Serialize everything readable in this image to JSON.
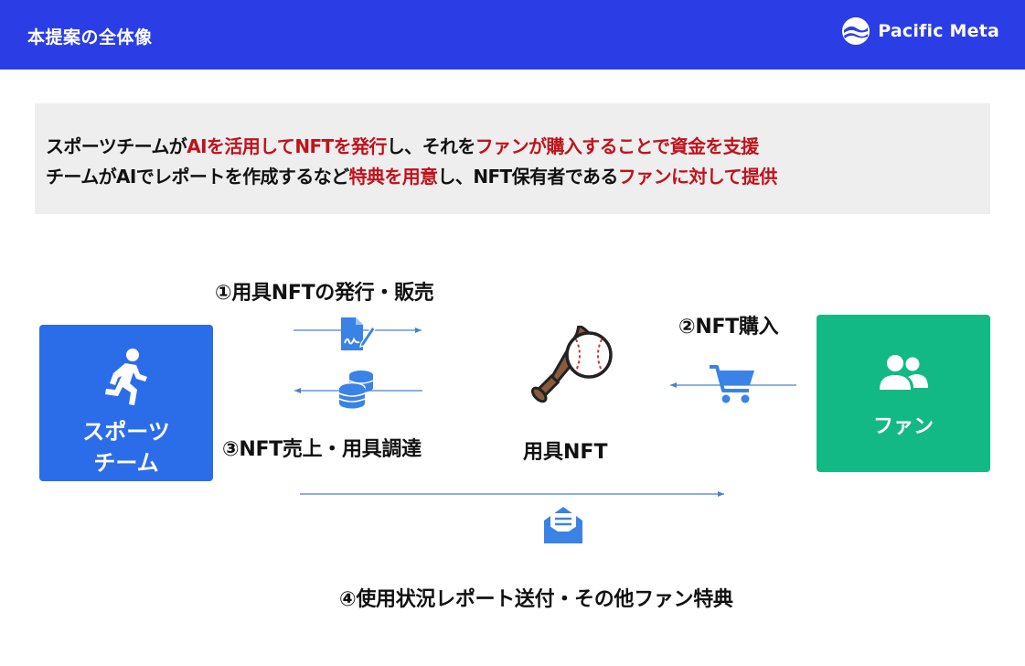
{
  "header": {
    "title": "本提案の全体像",
    "brand": "Pacific Meta",
    "background": "#2b3ee6"
  },
  "summary": {
    "line1": [
      {
        "text": "スポーツチームが",
        "highlight": false
      },
      {
        "text": "AIを活用してNFTを発行",
        "highlight": true
      },
      {
        "text": "し、それを",
        "highlight": false
      },
      {
        "text": "ファンが購入することで資金を支援",
        "highlight": true
      }
    ],
    "line2": [
      {
        "text": "チームがAIでレポートを作成するなど",
        "highlight": false
      },
      {
        "text": "特典を用意",
        "highlight": true
      },
      {
        "text": "し、NFT保有者である",
        "highlight": false
      },
      {
        "text": "ファンに対して提供",
        "highlight": true
      }
    ],
    "highlight_color": "#c0121b"
  },
  "actors": {
    "team": {
      "label_line1": "スポーツ",
      "label_line2": "チーム",
      "icon": "running-person-icon",
      "color": "#2b6de9"
    },
    "fan": {
      "label": "ファン",
      "icon": "users-icon",
      "color": "#13b985"
    }
  },
  "center": {
    "label": "用具NFT",
    "icon": "baseball-bat-ball-icon"
  },
  "steps": {
    "step1": "①用具NFTの発行・販売",
    "step2": "②NFT購入",
    "step3": "③NFT売上・用具調達",
    "step4": "④使用状況レポート送付・その他ファン特典"
  },
  "flow_icons": {
    "issue": "file-signature-icon",
    "purchase": "shopping-cart-icon",
    "revenue": "coins-stack-icon",
    "report": "envelope-open-text-icon"
  },
  "arrow_color": "#4a7fd0",
  "icon_color": "#3b82e6"
}
